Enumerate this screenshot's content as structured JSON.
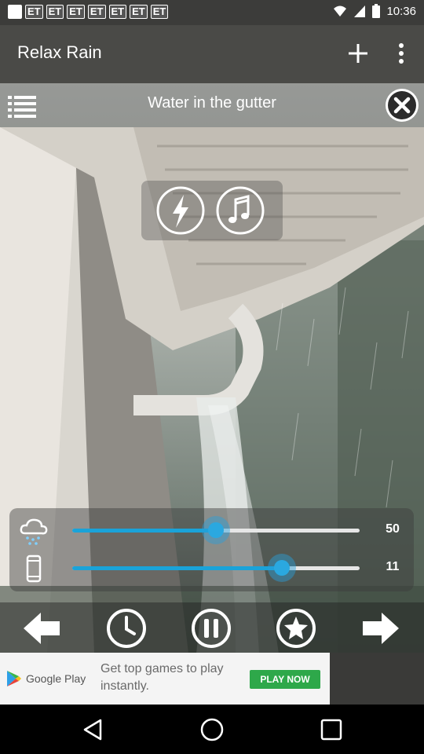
{
  "status_bar": {
    "notifications": [
      "ET",
      "ET",
      "ET",
      "ET",
      "ET",
      "ET",
      "ET"
    ],
    "time": "10:36"
  },
  "app_bar": {
    "title": "Relax Rain",
    "add_icon": "plus-icon",
    "more_icon": "more-vert-icon"
  },
  "track_bar": {
    "title": "Water in the gutter",
    "list_icon": "playlist-icon",
    "close_icon": "close-circle-icon"
  },
  "effects": [
    {
      "icon": "lightning-icon"
    },
    {
      "icon": "music-note-icon"
    }
  ],
  "sliders": {
    "rain": {
      "icon": "rain-cloud-icon",
      "value": "50",
      "fraction": 0.5
    },
    "phone": {
      "icon": "phone-icon",
      "value": "11",
      "fraction": 0.73
    }
  },
  "controls": [
    {
      "icon": "arrow-left-icon"
    },
    {
      "icon": "timer-icon"
    },
    {
      "icon": "pause-icon"
    },
    {
      "icon": "star-icon"
    },
    {
      "icon": "arrow-right-icon"
    }
  ],
  "ad": {
    "store": "Google Play",
    "text": "Get top games to play instantly.",
    "cta": "PLAY NOW"
  },
  "colors": {
    "accent": "#1aa3d9",
    "app_bar": "#4a4a47",
    "ad_cta": "#2ea84a"
  }
}
